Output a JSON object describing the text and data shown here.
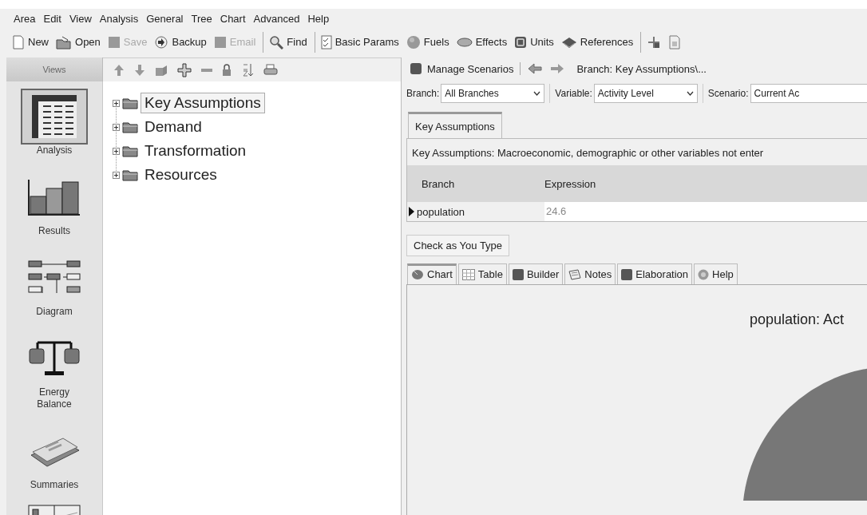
{
  "menu": [
    "Area",
    "Edit",
    "View",
    "Analysis",
    "General",
    "Tree",
    "Chart",
    "Advanced",
    "Help"
  ],
  "toolbar": [
    [
      {
        "label": "New",
        "disabled": false
      },
      {
        "label": "Open",
        "disabled": false
      },
      {
        "label": "Save",
        "disabled": true
      },
      {
        "label": "Backup",
        "disabled": false
      },
      {
        "label": "Email",
        "disabled": true
      }
    ],
    [
      {
        "label": "Find",
        "disabled": false
      }
    ],
    [
      {
        "label": "Basic Params",
        "disabled": false
      },
      {
        "label": "Fuels",
        "disabled": false
      },
      {
        "label": "Effects",
        "disabled": false
      },
      {
        "label": "Units",
        "disabled": false
      },
      {
        "label": "References",
        "disabled": false
      }
    ]
  ],
  "views_header": "Views",
  "views": [
    {
      "label": "Analysis",
      "selected": true
    },
    {
      "label": "Results",
      "selected": false
    },
    {
      "label": "Diagram",
      "selected": false
    },
    {
      "label": "Energy Balance",
      "selected": false
    },
    {
      "label": "Summaries",
      "selected": false
    }
  ],
  "tree": [
    {
      "label": "Key Assumptions",
      "selected": true,
      "expanded": false
    },
    {
      "label": "Demand",
      "selected": false,
      "expanded": false
    },
    {
      "label": "Transformation",
      "selected": false,
      "expanded": false
    },
    {
      "label": "Resources",
      "selected": false,
      "expanded": false
    }
  ],
  "scenario_bar": {
    "button": "Manage Scenarios",
    "breadcrumb": "Branch: Key Assumptions\\..."
  },
  "filters": [
    {
      "label": "Branch:",
      "value": "All Branches",
      "caret": true
    },
    {
      "label": "Variable:",
      "value": "Activity Level",
      "caret": true
    },
    {
      "label": "Scenario:",
      "value": "Current Ac"
    }
  ],
  "branch_tabs": [
    {
      "label": "Key Assumptions",
      "selected": true
    }
  ],
  "description": "Key Assumptions: Macroeconomic, demographic or other variables not enter",
  "table": {
    "columns": [
      "Branch",
      "Expression"
    ],
    "rows": [
      {
        "cells": [
          "population",
          "24.6"
        ],
        "selected": true
      }
    ]
  },
  "check_button": "Check as You Type",
  "bottom_tabs": [
    {
      "label": "Chart",
      "selected": true
    },
    {
      "label": "Table",
      "selected": false
    },
    {
      "label": "Builder",
      "selected": false
    },
    {
      "label": "Notes",
      "selected": false
    },
    {
      "label": "Elaboration",
      "selected": false
    },
    {
      "label": "Help",
      "selected": false
    }
  ],
  "chart": {
    "title": "population: Act"
  }
}
